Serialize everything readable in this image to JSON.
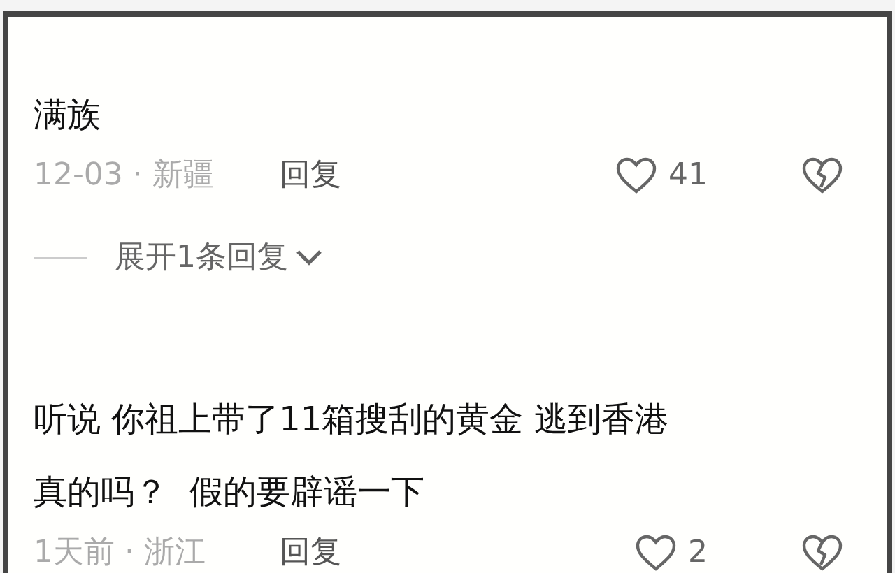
{
  "comments": [
    {
      "text": "满族",
      "meta": "12-03 · 新疆",
      "reply_label": "回复",
      "likes": "41",
      "expand_label": "展开1条回复"
    },
    {
      "text": "听说 你祖上带了11箱搜刮的黄金 逃到香港真的吗？  假的要辟谣一下",
      "meta": "1天前 · 浙江",
      "reply_label": "回复",
      "likes": "2"
    }
  ]
}
